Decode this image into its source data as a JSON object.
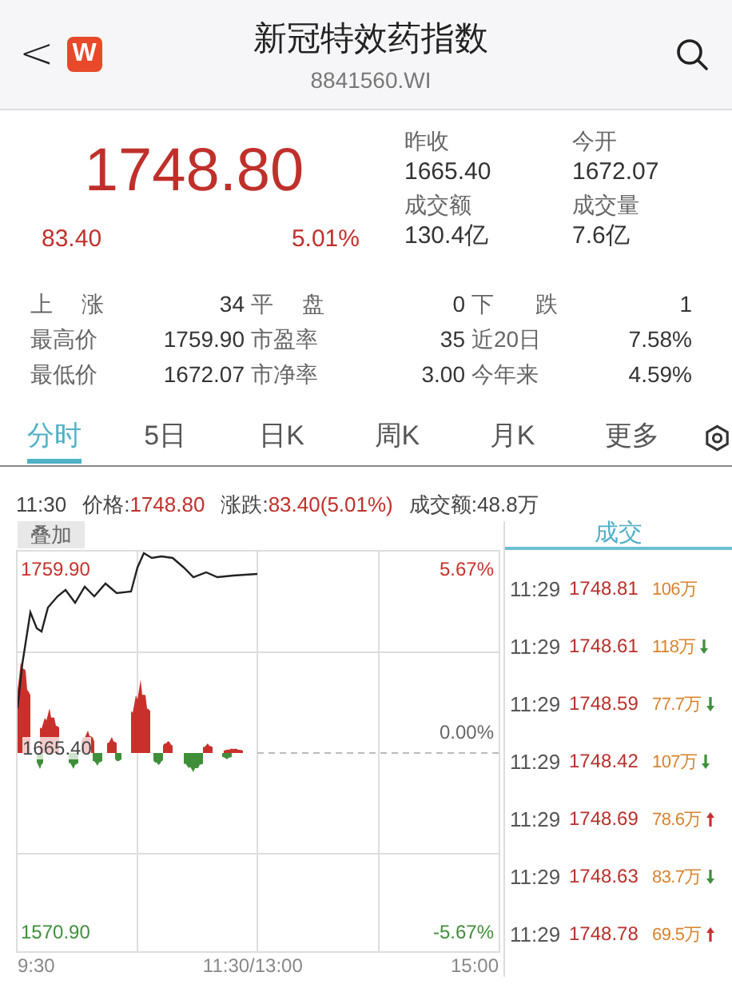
{
  "header": {
    "back": "<",
    "logo": "W",
    "title": "新冠特效药指数",
    "code": "8841560.WI"
  },
  "quote": {
    "price": "1748.80",
    "change": "83.40",
    "change_pct": "5.01%",
    "summary": [
      {
        "label": "昨收",
        "value": "1665.40"
      },
      {
        "label": "今开",
        "value": "1672.07"
      },
      {
        "label": "成交额",
        "value": "130.4亿"
      },
      {
        "label": "成交量",
        "value": "7.6亿"
      }
    ],
    "stats": [
      {
        "label": "上涨",
        "value": "34"
      },
      {
        "label": "平盘",
        "value": "0"
      },
      {
        "label": "下跌",
        "value": "1"
      },
      {
        "label": "最高价",
        "value": "1759.90"
      },
      {
        "label": "市盈率",
        "value": "35"
      },
      {
        "label": "近20日",
        "value": "7.58%"
      },
      {
        "label": "最低价",
        "value": "1672.07"
      },
      {
        "label": "市净率",
        "value": "3.00"
      },
      {
        "label": "今年来",
        "value": "4.59%"
      }
    ]
  },
  "tabs": [
    {
      "label": "分时",
      "selected": true
    },
    {
      "label": "5日",
      "selected": false
    },
    {
      "label": "日K",
      "selected": false
    },
    {
      "label": "周K",
      "selected": false
    },
    {
      "label": "月K",
      "selected": false
    },
    {
      "label": "更多",
      "selected": false
    }
  ],
  "info_bar": {
    "time": "11:30",
    "price_label": "价格:",
    "price": "1748.80",
    "change_label": "涨跌:",
    "change": "83.40(5.01%)",
    "amount_label": "成交额:",
    "amount": "48.8万"
  },
  "chart": {
    "overlay_button": "叠加",
    "high": "1759.90",
    "low": "1570.90",
    "mid": "1665.40",
    "pct_high": "5.67%",
    "pct_mid": "0.00%",
    "pct_low": "-5.67%",
    "times": [
      "9:30",
      "11:30/13:00",
      "15:00"
    ]
  },
  "trades": {
    "title": "成交",
    "rows": [
      {
        "time": "11:29",
        "price": "1748.81",
        "volume": "106万",
        "kind": "plain"
      },
      {
        "time": "11:29",
        "price": "1748.61",
        "volume": "118万",
        "kind": "down"
      },
      {
        "time": "11:29",
        "price": "1748.59",
        "volume": "77.7万",
        "kind": "down"
      },
      {
        "time": "11:29",
        "price": "1748.42",
        "volume": "107万",
        "kind": "down"
      },
      {
        "time": "11:29",
        "price": "1748.69",
        "volume": "78.6万",
        "kind": "up"
      },
      {
        "time": "11:29",
        "price": "1748.63",
        "volume": "83.7万",
        "kind": "down"
      },
      {
        "time": "11:29",
        "price": "1748.78",
        "volume": "69.5万",
        "kind": "up"
      }
    ]
  }
}
